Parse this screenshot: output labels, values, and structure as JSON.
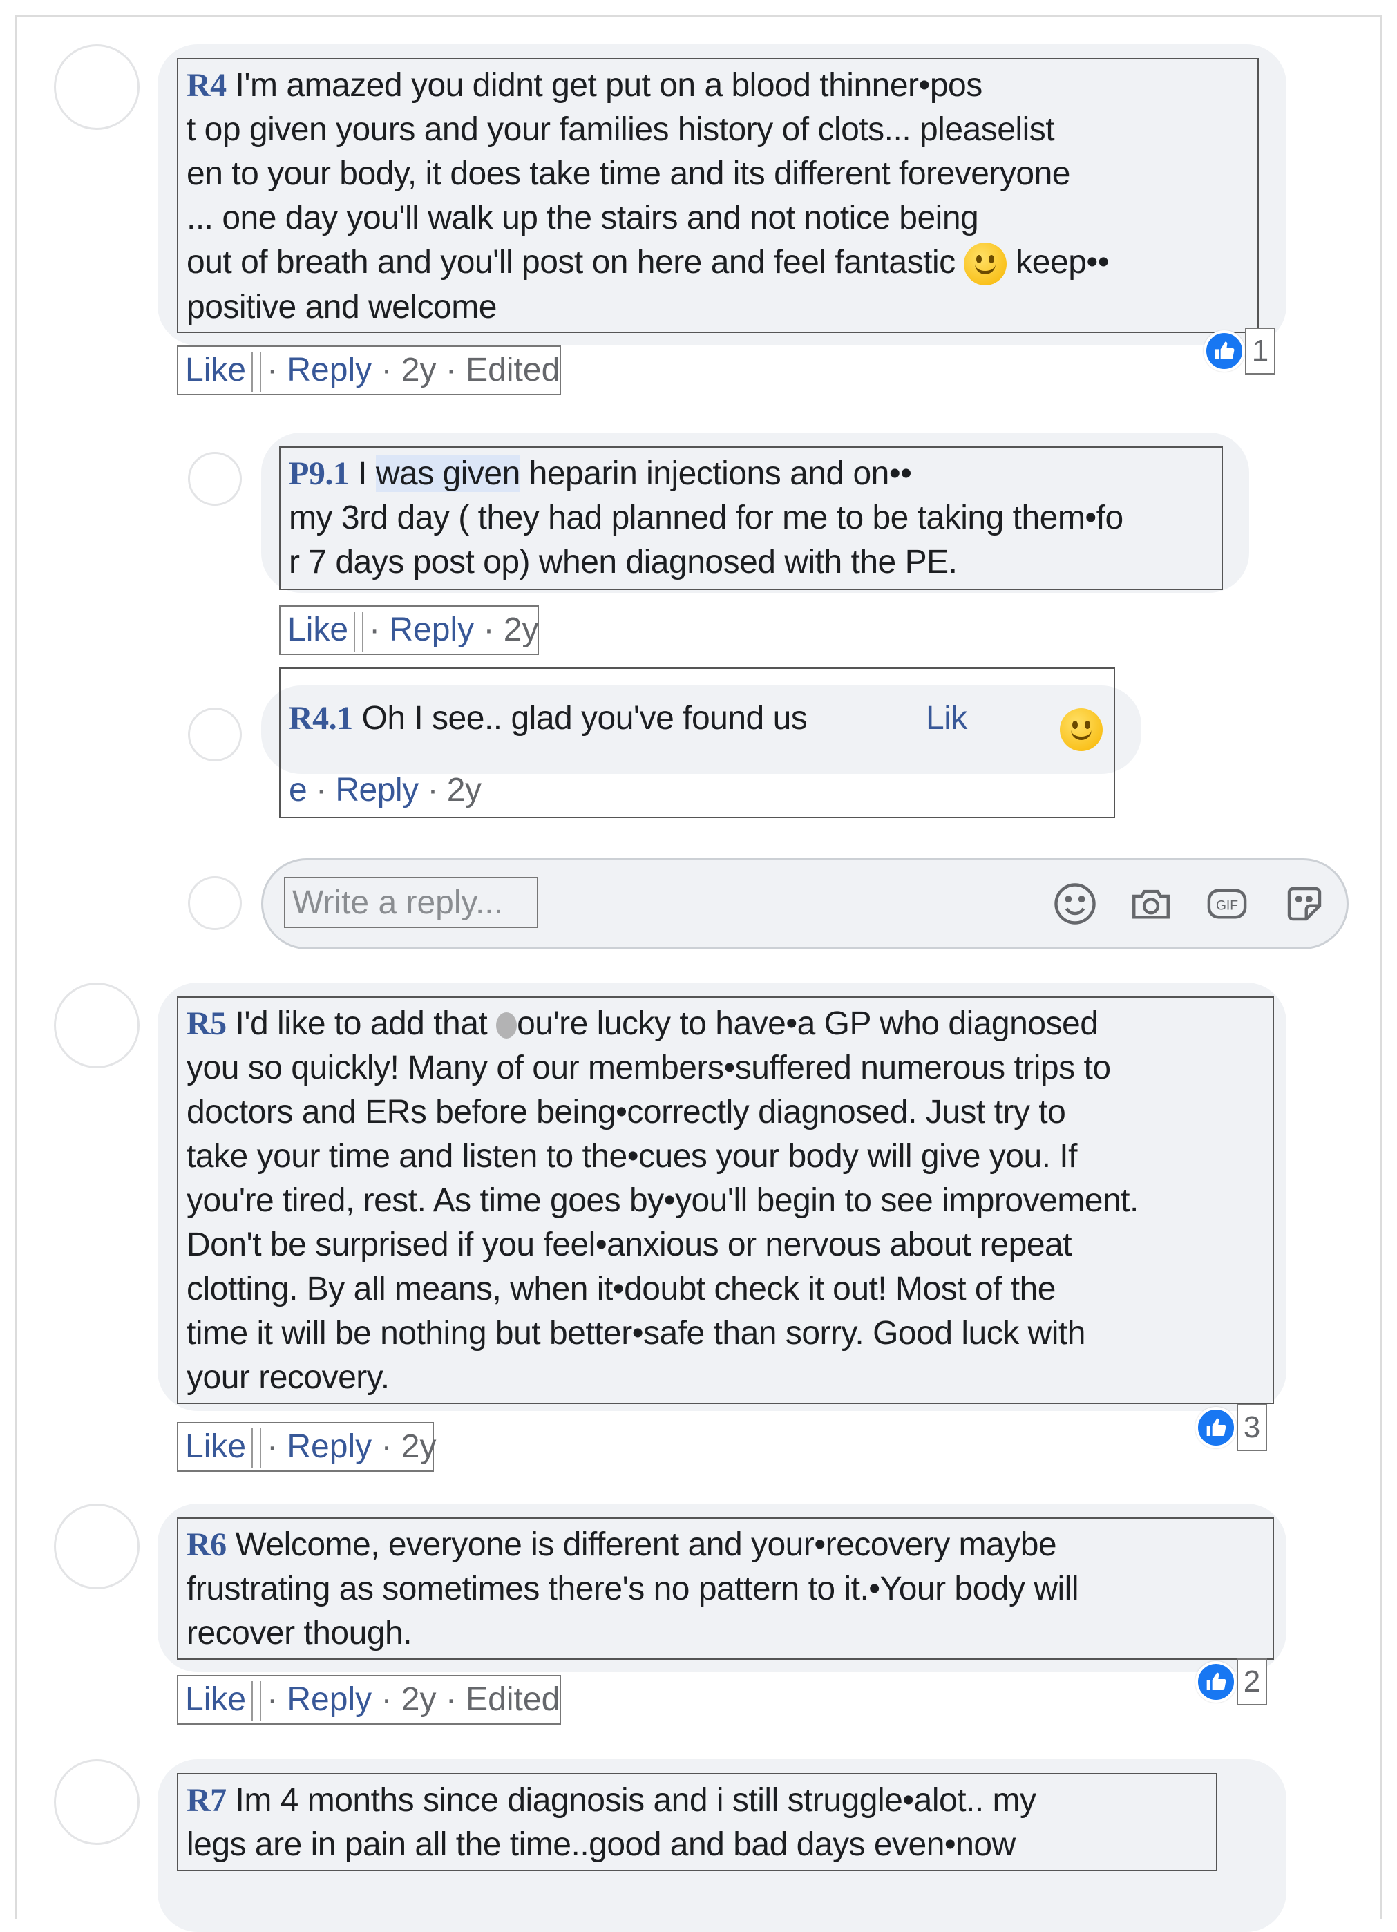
{
  "colors": {
    "link": "#385898",
    "bubble": "#f0f2f5",
    "like_badge": "#1877f2",
    "meta": "#65676b"
  },
  "comments": [
    {
      "tag": "R4",
      "text_lines": [
        "I'm amazed you didnt get put on a blood thinner•pos",
        "t op given yours and your families history of clots... pleaselist",
        "en to your body, it does take time and its different foreveryone",
        "... one day you'll walk up the stairs and not notice being",
        "out of breath and you'll post on here and feel fantastic",
        "keep••",
        "positive and welcome"
      ],
      "actions": {
        "like": "Like",
        "reply": "Reply",
        "dot": "·",
        "age": "2y",
        "edited": "Edited"
      },
      "reaction_count": "1"
    },
    {
      "tag": "P9.1",
      "text_lines": [
        "I",
        "was given",
        "heparin injections and on••",
        "my 3rd day ( they had planned for me to be taking them•fo",
        "r 7 days post op) when diagnosed with the PE."
      ],
      "actions": {
        "like": "Like",
        "reply": "Reply",
        "dot": "·",
        "age": "2y"
      }
    },
    {
      "tag": "R4.1",
      "text": "Oh I see.. glad you've found us",
      "like_a": "Lik",
      "like_b": "e",
      "actions": {
        "reply": "Reply",
        "dot": "·",
        "age": "2y"
      }
    },
    {
      "tag": "R5",
      "text_lines": [
        "I'd like to add that",
        "ou're lucky to have•a GP who diagnosed",
        "you so quickly! Many of our members•suffered numerous trips to",
        "doctors and ERs before being•correctly diagnosed. Just try to",
        "take your time and listen to the•cues your body will give you. If",
        "you're tired, rest. As time goes by•you'll begin to see improvement.",
        "Don't be surprised if you feel•anxious or nervous about repeat",
        "clotting. By all means, when it•doubt check it out! Most of the",
        "time it will be nothing but better•safe than sorry. Good luck with",
        "your recovery."
      ],
      "actions": {
        "like": "Like",
        "reply": "Reply",
        "dot": "·",
        "age": "2y"
      },
      "reaction_count": "3"
    },
    {
      "tag": "R6",
      "text_lines": [
        "Welcome, everyone is different and your•recovery maybe",
        "frustrating as sometimes there's no pattern to it.•Your body will",
        "recover though."
      ],
      "actions": {
        "like": "Like",
        "reply": "Reply",
        "dot": "·",
        "age": "2y",
        "edited": "Edited"
      },
      "reaction_count": "2"
    },
    {
      "tag": "R7",
      "text_lines": [
        "Im 4 months since diagnosis and i still struggle•alot.. my",
        "legs are in pain all the time..good and bad days even•now"
      ]
    }
  ],
  "reply_box": {
    "placeholder": "Write a reply...",
    "icons": [
      "emoji-icon",
      "camera-icon",
      "gif-icon",
      "sticker-icon"
    ],
    "gif_label": "GIF"
  }
}
